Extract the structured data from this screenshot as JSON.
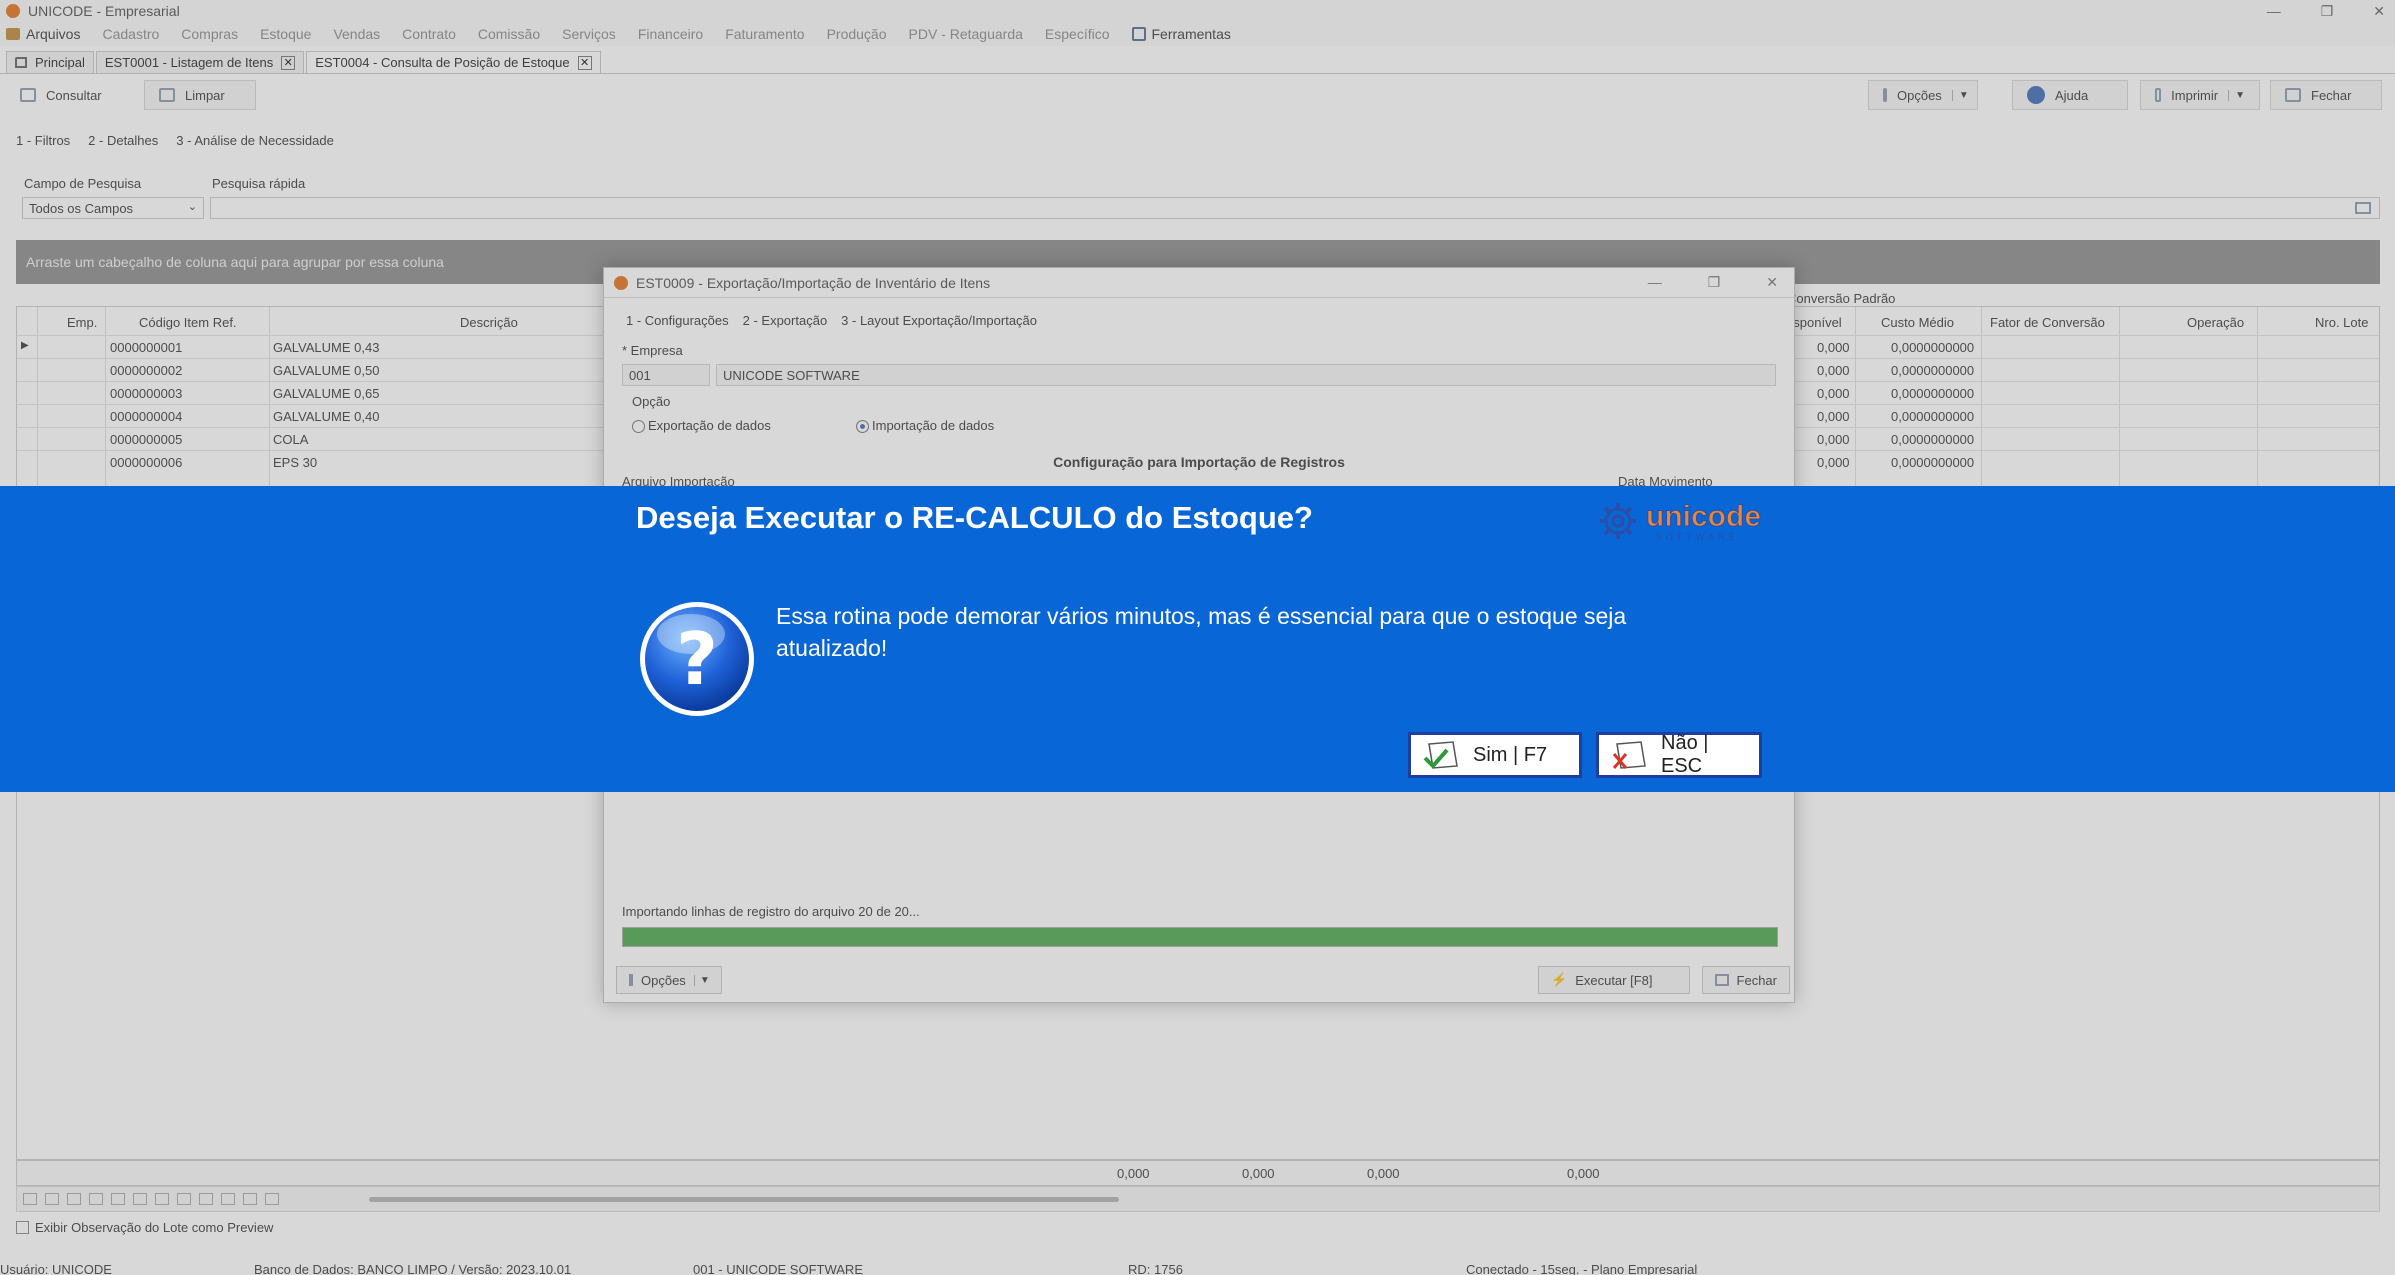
{
  "window": {
    "title": "UNICODE - Empresarial",
    "controls": [
      "—",
      "❐",
      "✕"
    ]
  },
  "menu": {
    "items": [
      "Arquivos",
      "Cadastro",
      "Compras",
      "Estoque",
      "Vendas",
      "Contrato",
      "Comissão",
      "Serviços",
      "Financeiro",
      "Faturamento",
      "Produção",
      "PDV - Retaguarda",
      "Específico",
      "Ferramentas"
    ]
  },
  "tabs": [
    {
      "label": "Principal"
    },
    {
      "label": "EST0001 - Listagem de Itens"
    },
    {
      "label": "EST0004 - Consulta de Posição de Estoque"
    }
  ],
  "toolbar": {
    "consultar": "Consultar",
    "limpar": "Limpar",
    "opcoes": "Opções",
    "ajuda": "Ajuda",
    "imprimir": "Imprimir",
    "fechar": "Fechar"
  },
  "subtabs": [
    "1 - Filtros",
    "2 - Detalhes",
    "3 - Análise de Necessidade"
  ],
  "filters": {
    "campo_label": "Campo de Pesquisa",
    "campo_value": "Todos os Campos",
    "pesquisa_label": "Pesquisa rápida"
  },
  "group_hint": "Arraste um cabeçalho de coluna aqui para agrupar por essa coluna",
  "grid": {
    "group_header": "Conversão Padrão",
    "headers": {
      "emp": "Emp.",
      "codigo": "Código Item Ref.",
      "descricao": "Descrição",
      "disponivel": "Disponível",
      "custo_medio": "Custo Médio",
      "fator": "Fator de Conversão",
      "operacao": "Operação",
      "nro_lote": "Nro. Lote"
    },
    "rows": [
      {
        "codigo": "0000000001",
        "descricao": "GALVALUME 0,43",
        "disp": "0,000",
        "custo": "0,0000000000"
      },
      {
        "codigo": "0000000002",
        "descricao": "GALVALUME 0,50",
        "disp": "0,000",
        "custo": "0,0000000000"
      },
      {
        "codigo": "0000000003",
        "descricao": "GALVALUME 0,65",
        "disp": "0,000",
        "custo": "0,0000000000"
      },
      {
        "codigo": "0000000004",
        "descricao": "GALVALUME 0,40",
        "disp": "0,000",
        "custo": "0,0000000000"
      },
      {
        "codigo": "0000000005",
        "descricao": "COLA",
        "disp": "0,000",
        "custo": "0,0000000000"
      },
      {
        "codigo": "0000000006",
        "descricao": "EPS 30",
        "disp": "0,000",
        "custo": "0,0000000000"
      }
    ],
    "totals": [
      "0,000",
      "0,000",
      "0,000",
      "0,000"
    ]
  },
  "show_obs": "Exibir Observação do Lote como Preview",
  "status": {
    "usuario": "Usuário: UNICODE",
    "banco": "Banco de Dados: BANCO LIMPO / Versão: 2023.10.01",
    "empresa": "001 - UNICODE SOFTWARE",
    "rd": "RD: 1756",
    "conexao": "Conectado - 15seg. - Plano Empresarial"
  },
  "dialog": {
    "title": "EST0009 - Exportação/Importação de Inventário de Itens",
    "tabs": [
      "1 - Configurações",
      "2 - Exportação",
      "3 - Layout Exportação/Importação"
    ],
    "empresa_label": "* Empresa",
    "empresa_code": "001",
    "empresa_name": "UNICODE SOFTWARE",
    "opcao_label": "Opção",
    "radio_export": "Exportação de dados",
    "radio_import": "Importação de dados",
    "section": "Configuração para Importação de Registros",
    "arquivo_label": "Arquivo Importação",
    "data_label": "Data Movimento",
    "progress_text": "Importando linhas de registro do arquivo 20 de 20...",
    "progress_value": 1.0,
    "opcoes": "Opções",
    "executar": "Executar [F8]",
    "fechar": "Fechar"
  },
  "banner": {
    "title": "Deseja Executar o RE-CALCULO do Estoque?",
    "message": "Essa rotina pode demorar vários minutos, mas é essencial para que o estoque seja atualizado!",
    "yes": "Sim | F7",
    "no": "Não | ESC",
    "logo_text": "unicode",
    "logo_sub": "SOFTWARE",
    "bg_color": "#0866d6"
  }
}
